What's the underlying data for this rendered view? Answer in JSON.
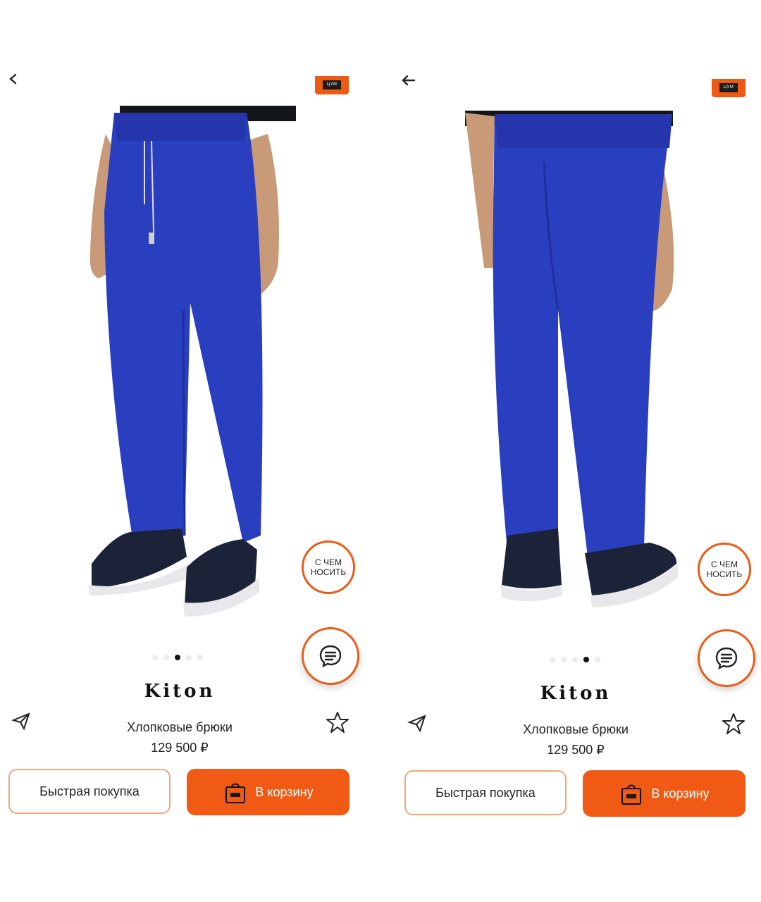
{
  "screens": [
    {
      "brand_badge": "ЦУМ",
      "wear_button": "С ЧЕМ НОСИТЬ",
      "brand_logo": "Kiton",
      "product_name": "Хлопковые брюки",
      "price": "129 500 ₽",
      "quick_buy": "Быстрая покупка",
      "add_to_cart": "В корзину",
      "carousel_active_index": 2,
      "carousel_total": 5,
      "photo_view": "front"
    },
    {
      "brand_badge": "ЦУМ",
      "wear_button": "С ЧЕМ НОСИТЬ",
      "brand_logo": "Kiton",
      "product_name": "Хлопковые брюки",
      "price": "129 500 ₽",
      "quick_buy": "Быстрая покупка",
      "add_to_cart": "В корзину",
      "carousel_active_index": 3,
      "carousel_total": 5,
      "photo_view": "back"
    }
  ],
  "colors": {
    "accent": "#f05a14",
    "accent_border": "#f0a57a",
    "pants": "#2a3fbf",
    "shoes": "#1c2238"
  },
  "icons": [
    "back-arrow-icon",
    "brand-logo-icon",
    "chat-icon",
    "share-send-icon",
    "star-icon",
    "shopping-bag-icon"
  ]
}
